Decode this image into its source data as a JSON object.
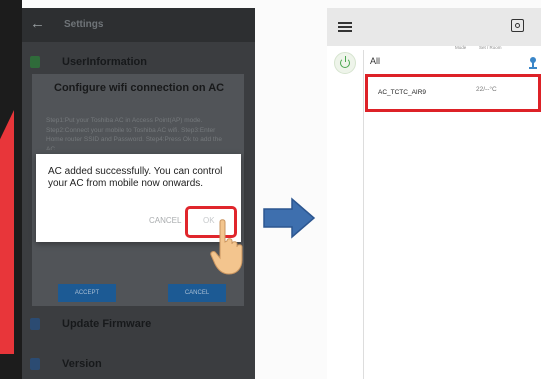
{
  "left_phone": {
    "app_bar": {
      "title": "Settings",
      "back_icon": "back-arrow-icon"
    },
    "sections": [
      {
        "label": "UserInformation",
        "icon": "user-icon"
      },
      {
        "label": "Update Firmware",
        "icon": "info-icon"
      },
      {
        "label": "Version",
        "icon": "info-icon"
      }
    ],
    "wifi_dialog": {
      "title": "Configure wifi connection on AC",
      "steps": "Step1:Put your Toshiba AC in Access Point(AP) mode. Step2:Connect your mobile to Toshiba AC wifi. Step3:Enter Home router SSID and Password. Step4:Press Ok to add the AC",
      "accept_label": "ACCEPT",
      "cancel_label": "CANCEL"
    },
    "added_dialog": {
      "message": "AC added successfully. You can control your AC from mobile now onwards.",
      "cancel_label": "CANCEL",
      "ok_label": "OK"
    }
  },
  "right_phone": {
    "menu_icon": "hamburger-menu-icon",
    "calendar_icon": "calendar-icon",
    "group_label": "All",
    "column_headers": {
      "mode": "Mode",
      "set_room": "Set / Room"
    },
    "device": {
      "name": "AC_TCTC_AIR9",
      "temperature": "22/--°C"
    }
  },
  "colors": {
    "highlight_red": "#e0262c",
    "arrow_blue": "#3e6fae",
    "power_green": "#4aa64f"
  }
}
